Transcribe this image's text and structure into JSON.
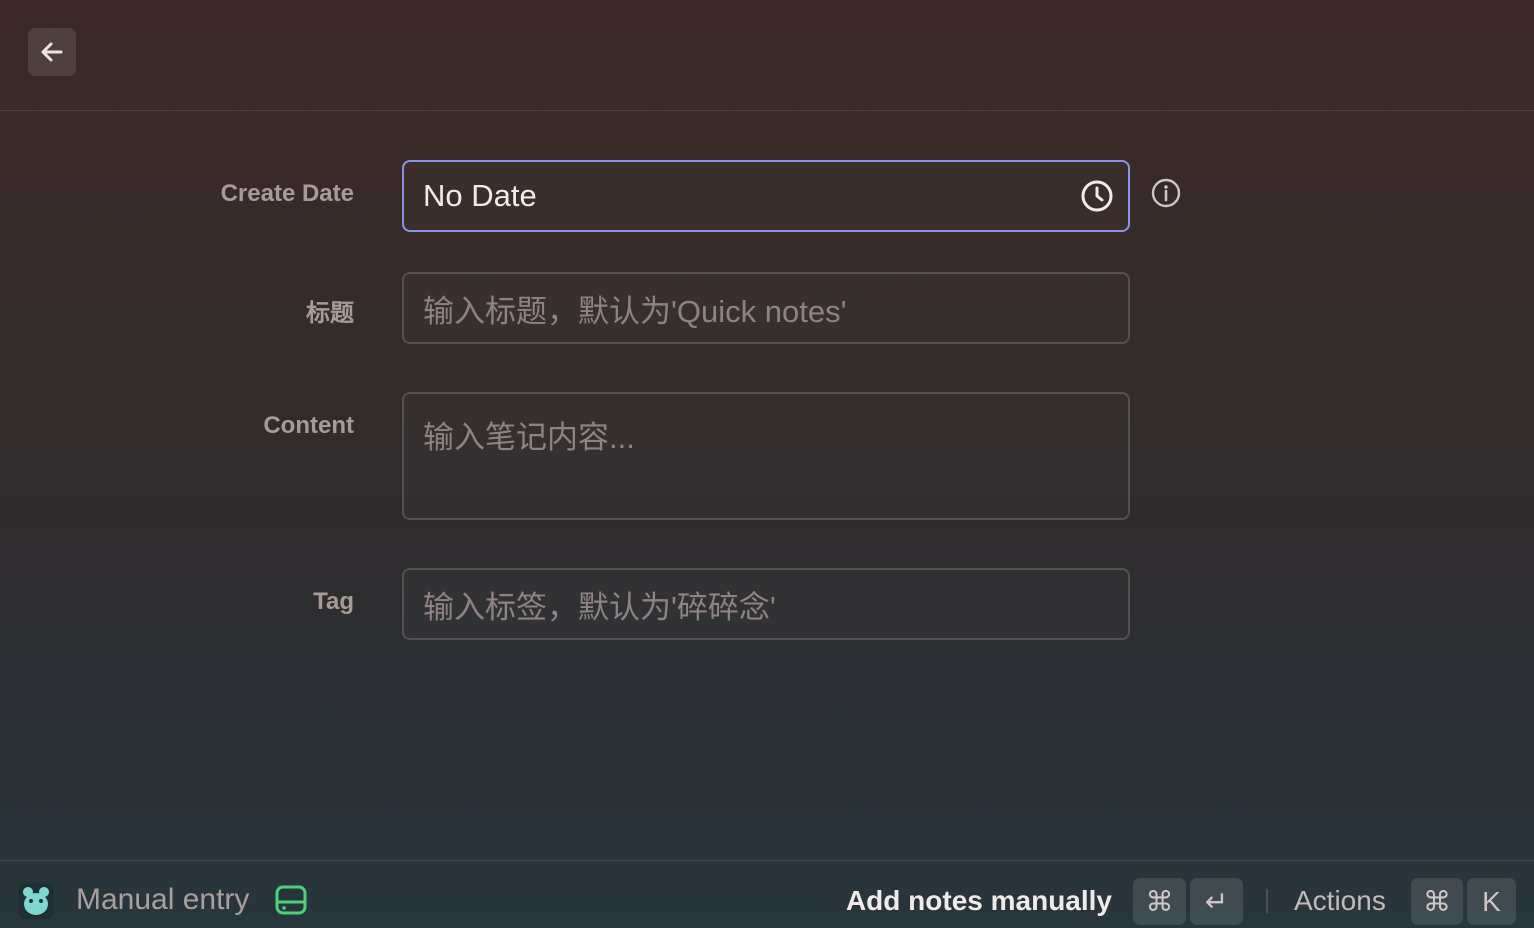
{
  "topbar": {
    "back_icon": "arrow-left-icon"
  },
  "form": {
    "create_date": {
      "label": "Create Date",
      "value": "No Date",
      "icon": "clock-icon",
      "info_icon": "info-icon"
    },
    "title": {
      "label": "标题",
      "placeholder": "输入标题，默认为'Quick notes'"
    },
    "content": {
      "label": "Content",
      "placeholder": "输入笔记内容..."
    },
    "tag": {
      "label": "Tag",
      "placeholder": "输入标签，默认为'碎碎念'"
    }
  },
  "bottombar": {
    "app_icon": "bear-app-icon",
    "title": "Manual entry",
    "status_icon": "drive-icon",
    "primary_action": "Add notes manually",
    "primary_shortcut": [
      "⌘",
      "↵"
    ],
    "actions_label": "Actions",
    "actions_shortcut": [
      "⌘",
      "K"
    ],
    "accent_color": "#4ed07a",
    "focus_color": "#8b93e8"
  }
}
